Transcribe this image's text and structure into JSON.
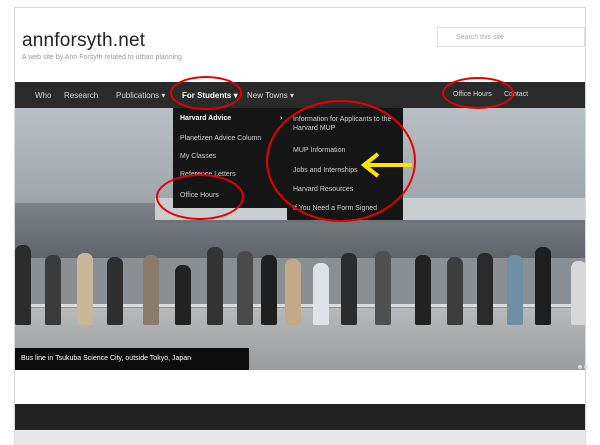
{
  "site": {
    "title": "annforsyth.net",
    "tagline": "A web site by Ann Forsyth related to urban planning"
  },
  "search": {
    "placeholder": "Search this site"
  },
  "nav": {
    "items": [
      "Who",
      "Research",
      "Publications",
      "For Students",
      "New Towns"
    ],
    "right_items": [
      "Office Hours",
      "Contact"
    ]
  },
  "students_menu": {
    "items": [
      "Harvard Advice",
      "Planetizen Advice Column",
      "My Classes",
      "Reference Letters",
      "Office Hours"
    ]
  },
  "harvard_submenu": {
    "items": [
      "Information for Applicants to the Harvard MUP",
      "MUP Information",
      "Jobs and Internships",
      "Harvard Resources",
      "If You Need a Form Signed"
    ]
  },
  "hero": {
    "caption": "Bus line in Tsukuba Science City, outside Tokyo, Japan"
  },
  "colors": {
    "annotation": "#e60000",
    "arrow": "#ffe600",
    "nav_bg": "#2a2a2a"
  },
  "icons": {
    "dropdown": "chevron-down-icon",
    "submenu": "chevron-right-icon",
    "pointer": "arrow-left-icon"
  }
}
